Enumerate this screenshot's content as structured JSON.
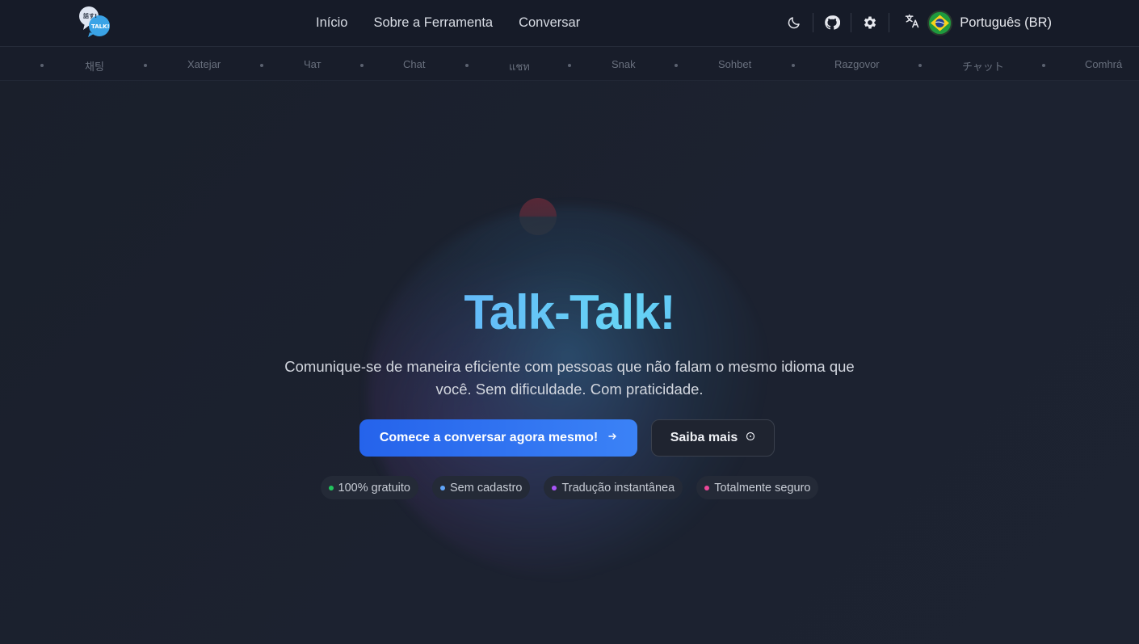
{
  "header": {
    "nav": [
      "Início",
      "Sobre a Ferramenta",
      "Conversar"
    ],
    "language_label": "Português (BR)",
    "icons": [
      "moon-icon",
      "github-icon",
      "gear-icon",
      "translate-icon",
      "brazil-flag-icon"
    ]
  },
  "marquee": {
    "words": [
      "채팅",
      "Xatejar",
      "Чат",
      "Chat",
      "แชท",
      "Snak",
      "Sohbet",
      "Razgovor",
      "チャット",
      "Comhrá"
    ]
  },
  "hero": {
    "title": "Talk-Talk!",
    "subtitle_line1": "Comunique-se de maneira eficiente com pessoas que não falam o mesmo idioma que",
    "subtitle_line2": "você. Sem dificuldade. Com praticidade.",
    "primary_button": "Comece a conversar agora mesmo!",
    "secondary_button": "Saiba mais",
    "badges": [
      {
        "label": "100% gratuito",
        "color": "#22c55e"
      },
      {
        "label": "Sem cadastro",
        "color": "#60a5fa"
      },
      {
        "label": "Tradução instantânea",
        "color": "#a855f7"
      },
      {
        "label": "Totalmente seguro",
        "color": "#ec4899"
      }
    ]
  },
  "colors": {
    "accent": "#3b82f6",
    "background": "#1a1f2c"
  }
}
